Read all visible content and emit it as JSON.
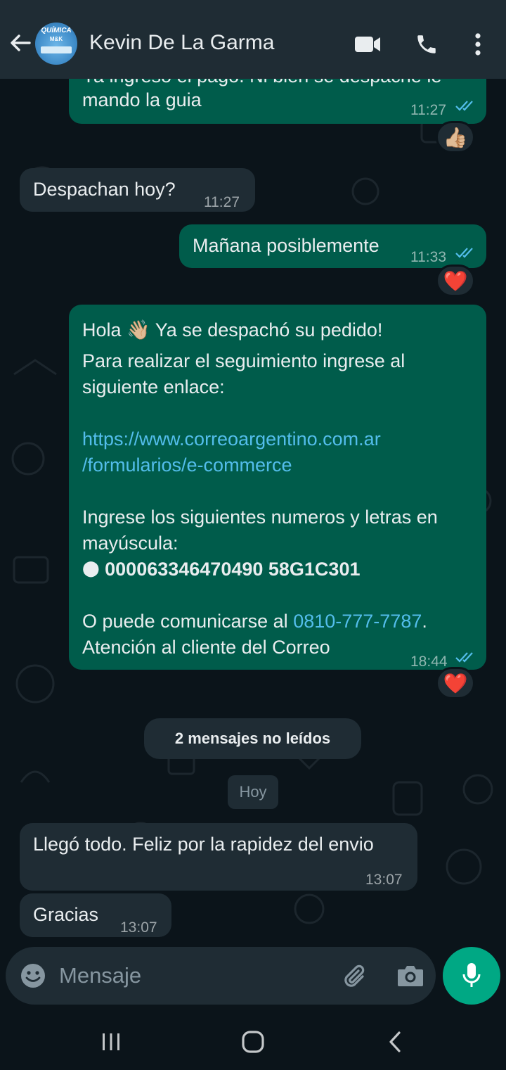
{
  "header": {
    "contact_name": "Kevin De La Garma",
    "avatar_text_1": "QUÍMICA",
    "avatar_text_2": "M&K"
  },
  "messages": [
    {
      "id": "m1",
      "direction": "outgoing",
      "text_1": "Ya ingresó el pago. Ni bien se despache le",
      "text_2": "mando la guia",
      "time": "11:27",
      "status": "read",
      "reaction": "👍🏼"
    },
    {
      "id": "m2",
      "direction": "incoming",
      "text": "Despachan hoy?",
      "time": "11:27"
    },
    {
      "id": "m3",
      "direction": "outgoing",
      "text": "Mañana posiblemente",
      "time": "11:33",
      "status": "read",
      "reaction": "❤️"
    },
    {
      "id": "m4",
      "direction": "outgoing",
      "greeting": "Hola",
      "wave": "👋🏼",
      "line1": "Ya se despachó su pedido!",
      "line2": "Para realizar el seguimiento ingrese al",
      "line3": "siguiente enlace:",
      "link_1": "https://www.correoargentino.com.ar",
      "link_2": "/formularios/e-commerce",
      "line4": "Ingrese los siguientes numeros y letras en",
      "line5": "mayúscula:",
      "bullet": "⬤",
      "tracking_code": "000063346470490 58G1C301",
      "line6_prefix": "O puede comunicarse al",
      "phone": "0810-777-7787",
      "line6_suffix": ".",
      "line7": "Atención al cliente del Correo",
      "time": "18:44",
      "status": "read",
      "reaction": "❤️"
    },
    {
      "id": "m5",
      "direction": "incoming",
      "text": "Llegó todo. Feliz por la rapidez del envio",
      "time": "13:07"
    },
    {
      "id": "m6",
      "direction": "incoming",
      "text": "Gracias",
      "time": "13:07"
    }
  ],
  "unread_pill": "2 mensajes no leídos",
  "day_label": "Hoy",
  "composer": {
    "placeholder": "Mensaje"
  },
  "colors": {
    "header": "#1f2c34",
    "outgoing": "#005c4b",
    "incoming": "#1f2c34",
    "accent": "#00a884",
    "link": "#53bdeb",
    "read_ticks": "#53bdeb"
  }
}
